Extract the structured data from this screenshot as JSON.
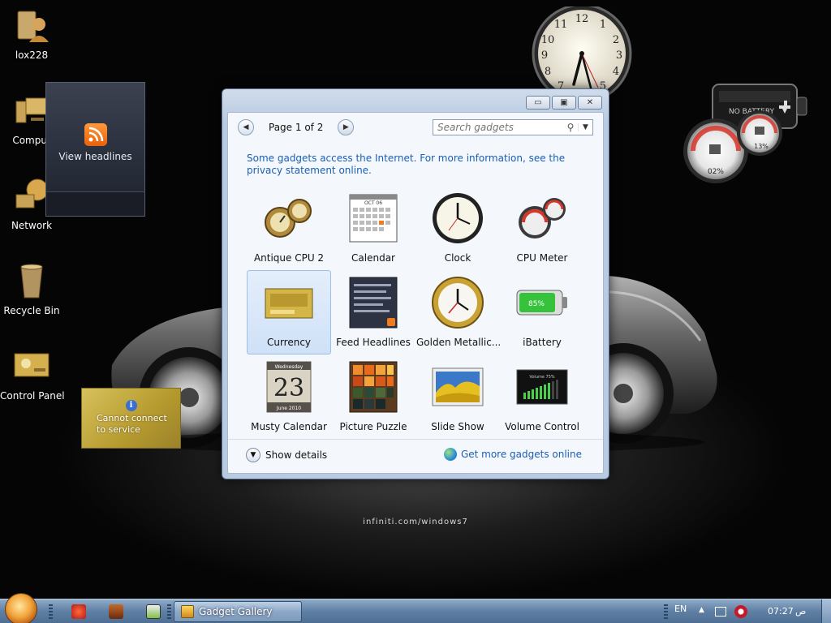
{
  "desktop": {
    "icons": [
      {
        "label": "lox228"
      },
      {
        "label": "Comput"
      },
      {
        "label": "Network"
      },
      {
        "label": "Recycle Bin"
      },
      {
        "label": "Control Panel"
      }
    ],
    "wallpaper_text": "infiniti.com/windows7"
  },
  "gadgets": {
    "feed_headlines": {
      "label": "View headlines"
    },
    "currency": {
      "message_line1": "Cannot connect",
      "message_line2": "to service"
    },
    "battery": {
      "label": "NO BATTERY"
    },
    "cpu_meter": {
      "cpu": "02%",
      "memory": "13%"
    }
  },
  "gallery": {
    "page_label": "Page 1 of 2",
    "search_placeholder": "Search gadgets",
    "notice": "Some gadgets access the Internet.  For more information, see the privacy statement online.",
    "items": [
      {
        "name": "Antique CPU 2"
      },
      {
        "name": "Calendar"
      },
      {
        "name": "Clock"
      },
      {
        "name": "CPU Meter"
      },
      {
        "name": "Currency"
      },
      {
        "name": "Feed Headlines"
      },
      {
        "name": "Golden Metallic..."
      },
      {
        "name": "iBattery"
      },
      {
        "name": "Musty Calendar"
      },
      {
        "name": "Picture Puzzle"
      },
      {
        "name": "Slide Show"
      },
      {
        "name": "Volume Control"
      }
    ],
    "calendar_month": "OCT 06",
    "battery_percent": "85%",
    "musty_calendar": {
      "weekday": "Wednesday",
      "day": "23",
      "month": "June 2010"
    },
    "volume_label": "Volume 75%",
    "show_details": "Show details",
    "more_online": "Get more gadgets online"
  },
  "taskbar": {
    "active_window": "Gadget Gallery",
    "language": "EN",
    "time": "07:27",
    "ampm": "ص"
  },
  "colors": {
    "link": "#1a5fb4",
    "accent": "#f2a43a"
  }
}
